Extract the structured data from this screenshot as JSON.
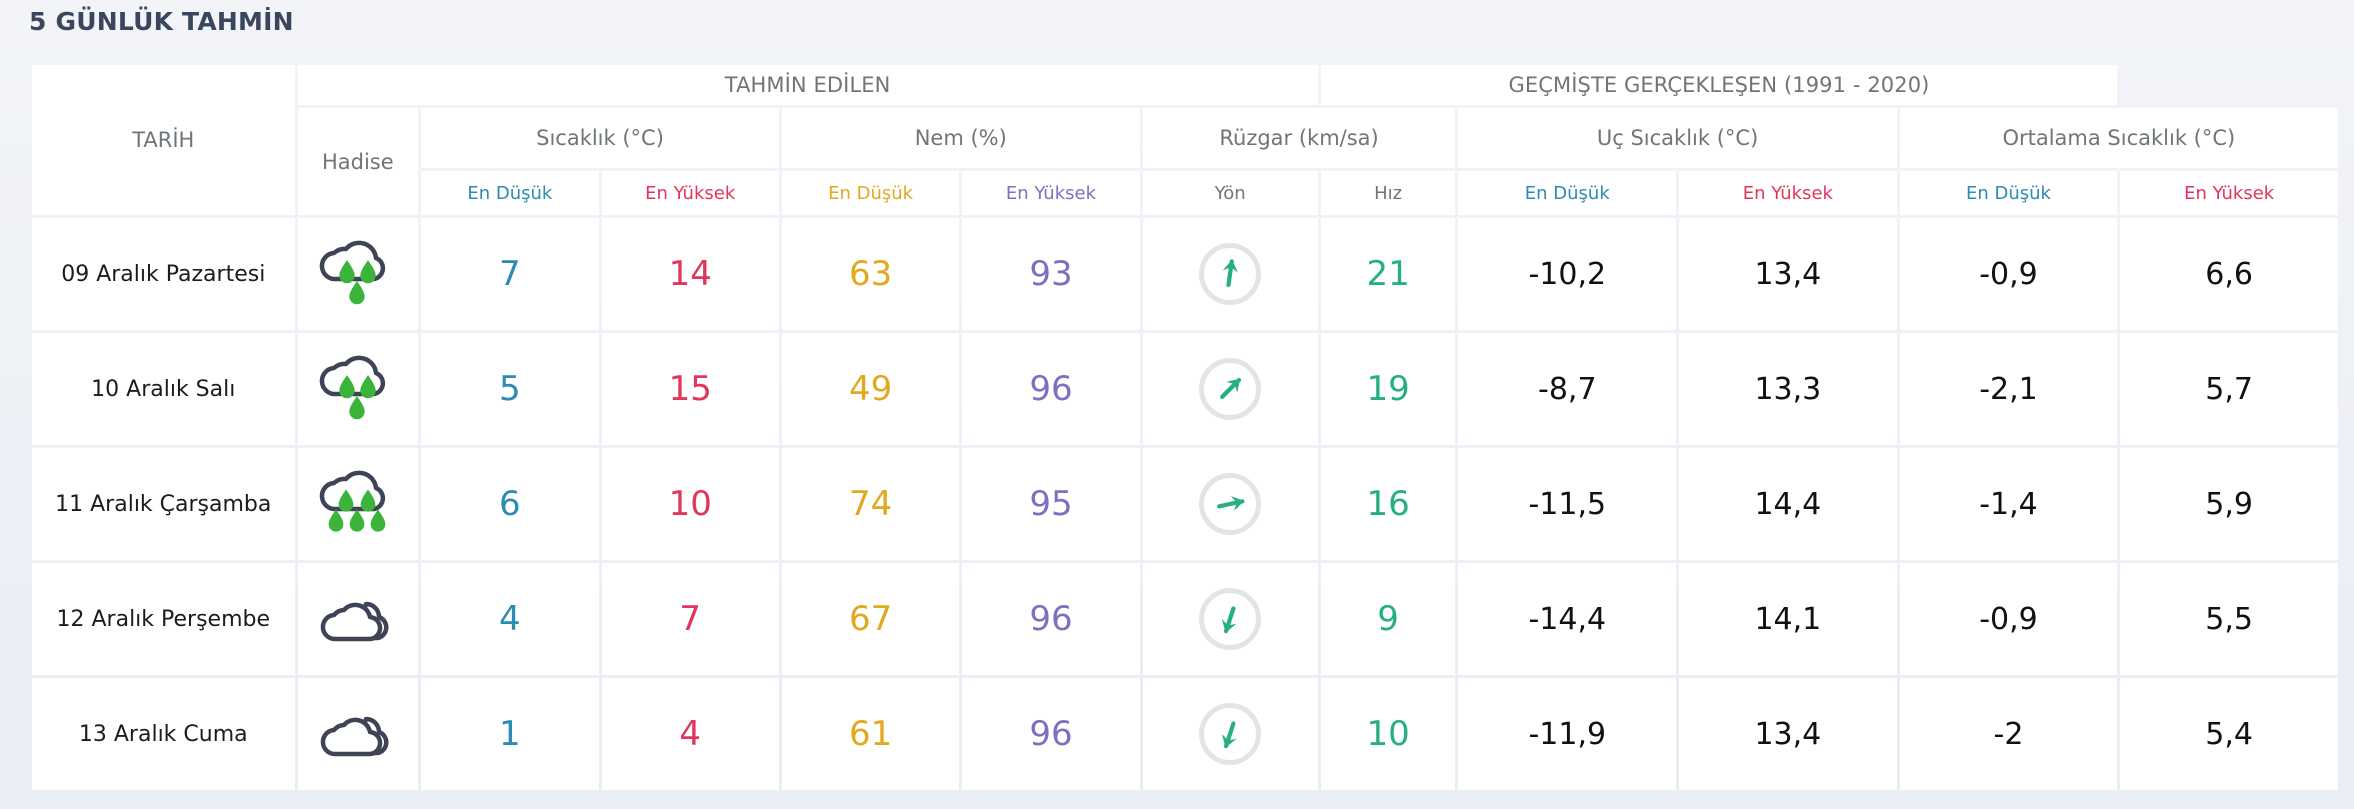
{
  "page": {
    "title": "5 GÜNLÜK TAHMİN",
    "background": "#eef1f6",
    "cell_background": "#ffffff"
  },
  "colors": {
    "title": "#38475e",
    "header_text": "#6f7579",
    "temp_low": "#2a8cb0",
    "temp_high": "#e0365c",
    "humidity_low": "#e0a920",
    "humidity_high": "#7a72c0",
    "wind_speed": "#27b07e",
    "rain_drop": "#3cb43c",
    "cloud_outline": "#3f4356",
    "plain_value": "#111111",
    "dial_ring": "#e2e5e8"
  },
  "table": {
    "groups": {
      "forecast": "TAHMİN EDİLEN",
      "historical": "GEÇMİŞTE GERÇEKLEŞEN (1991 - 2020)"
    },
    "subgroups": {
      "date": "TARİH",
      "hadise": "Hadise",
      "temperature": "Sıcaklık (°C)",
      "humidity": "Nem (%)",
      "wind": "Rüzgar (km/sa)",
      "extreme_temp": "Uç Sıcaklık (°C)",
      "average_temp": "Ortalama Sıcaklık (°C)"
    },
    "leaf_headers": {
      "temp_low": "En Düşük",
      "temp_high": "En Yüksek",
      "hum_low": "En Düşük",
      "hum_high": "En Yüksek",
      "wind_dir": "Yön",
      "wind_speed": "Hız",
      "ext_low": "En Düşük",
      "ext_high": "En Yüksek",
      "avg_low": "En Düşük",
      "avg_high": "En Yüksek"
    },
    "rows": [
      {
        "date": "09 Aralık Pazartesi",
        "hadise_icon": "rain-cloud-light-icon",
        "hadise_drops": 3,
        "temp_low": "7",
        "temp_high": "14",
        "hum_low": "63",
        "hum_high": "93",
        "wind_dir_icon": "arrow-north-icon",
        "wind_dir_deg": 8,
        "wind_speed": "21",
        "ext_low": "-10,2",
        "ext_high": "13,4",
        "avg_low": "-0,9",
        "avg_high": "6,6"
      },
      {
        "date": "10 Aralık Salı",
        "hadise_icon": "rain-cloud-light-icon",
        "hadise_drops": 3,
        "temp_low": "5",
        "temp_high": "15",
        "hum_low": "49",
        "hum_high": "96",
        "wind_dir_icon": "arrow-northeast-icon",
        "wind_dir_deg": 45,
        "wind_speed": "19",
        "ext_low": "-8,7",
        "ext_high": "13,3",
        "avg_low": "-2,1",
        "avg_high": "5,7"
      },
      {
        "date": "11 Aralık Çarşamba",
        "hadise_icon": "rain-cloud-heavy-icon",
        "hadise_drops": 5,
        "temp_low": "6",
        "temp_high": "10",
        "hum_low": "74",
        "hum_high": "95",
        "wind_dir_icon": "arrow-east-icon",
        "wind_dir_deg": 78,
        "wind_speed": "16",
        "ext_low": "-11,5",
        "ext_high": "14,4",
        "avg_low": "-1,4",
        "avg_high": "5,9"
      },
      {
        "date": "12 Aralık Perşembe",
        "hadise_icon": "cloudy-icon",
        "hadise_drops": 0,
        "temp_low": "4",
        "temp_high": "7",
        "hum_low": "67",
        "hum_high": "96",
        "wind_dir_icon": "arrow-south-southwest-icon",
        "wind_dir_deg": 198,
        "wind_speed": "9",
        "ext_low": "-14,4",
        "ext_high": "14,1",
        "avg_low": "-0,9",
        "avg_high": "5,5"
      },
      {
        "date": "13 Aralık Cuma",
        "hadise_icon": "cloudy-icon",
        "hadise_drops": 0,
        "temp_low": "1",
        "temp_high": "4",
        "hum_low": "61",
        "hum_high": "96",
        "wind_dir_icon": "arrow-south-southwest-icon",
        "wind_dir_deg": 198,
        "wind_speed": "10",
        "ext_low": "-11,9",
        "ext_high": "13,4",
        "avg_low": "-2",
        "avg_high": "5,4"
      }
    ]
  }
}
